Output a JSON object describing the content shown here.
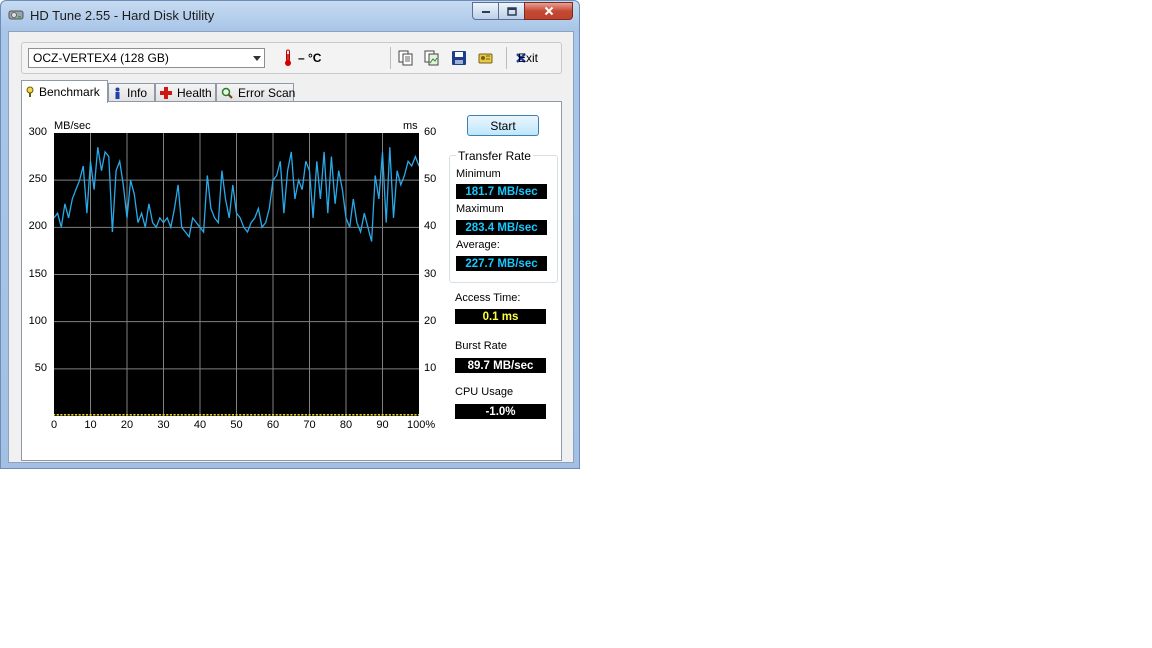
{
  "window": {
    "title": "HD Tune 2.55 - Hard Disk Utility"
  },
  "toolbar": {
    "drive": "OCZ-VERTEX4 (128 GB)",
    "temperature": "– °C",
    "exit_label": "Exit",
    "icons": [
      "copy-info-icon",
      "copy-screenshot-icon",
      "save-icon",
      "options-icon",
      "exit-icon"
    ]
  },
  "tabs": [
    {
      "label": "Benchmark",
      "icon": "benchmark-icon",
      "active": true
    },
    {
      "label": "Info",
      "icon": "info-icon",
      "active": false
    },
    {
      "label": "Health",
      "icon": "health-icon",
      "active": false
    },
    {
      "label": "Error Scan",
      "icon": "magnifier-icon",
      "active": false
    }
  ],
  "chart_data": {
    "type": "line",
    "left_unit": "MB/sec",
    "right_unit": "ms",
    "y_left_ticks": [
      "300",
      "250",
      "200",
      "150",
      "100",
      "50"
    ],
    "y_right_ticks": [
      "60",
      "50",
      "40",
      "30",
      "20",
      "10"
    ],
    "x_ticks": [
      "0",
      "10",
      "20",
      "30",
      "40",
      "50",
      "60",
      "70",
      "80",
      "90",
      "100%"
    ],
    "ylim": [
      0,
      300
    ],
    "ylim_right": [
      0,
      60
    ],
    "xlim": [
      0,
      100
    ],
    "grid": true,
    "series": [
      {
        "color": "#29a9e8",
        "x": [
          0,
          1,
          2,
          3,
          4,
          5,
          6,
          7,
          8,
          9,
          10,
          11,
          12,
          13,
          14,
          15,
          16,
          17,
          18,
          19,
          20,
          21,
          22,
          23,
          24,
          25,
          26,
          27,
          28,
          29,
          30,
          31,
          32,
          33,
          34,
          35,
          36,
          37,
          38,
          39,
          40,
          41,
          42,
          43,
          44,
          45,
          46,
          47,
          48,
          49,
          50,
          51,
          52,
          53,
          54,
          55,
          56,
          57,
          58,
          59,
          60,
          61,
          62,
          63,
          64,
          65,
          66,
          67,
          68,
          69,
          70,
          71,
          72,
          73,
          74,
          75,
          76,
          77,
          78,
          79,
          80,
          81,
          82,
          83,
          84,
          85,
          86,
          87,
          88,
          89,
          90,
          91,
          92,
          93,
          94,
          95,
          96,
          97,
          98,
          99,
          100
        ],
        "y": [
          210,
          215,
          200,
          225,
          210,
          230,
          240,
          250,
          265,
          215,
          270,
          240,
          285,
          260,
          280,
          275,
          195,
          260,
          270,
          245,
          210,
          250,
          235,
          205,
          215,
          200,
          225,
          205,
          200,
          210,
          205,
          210,
          200,
          220,
          245,
          200,
          195,
          190,
          210,
          205,
          200,
          195,
          255,
          220,
          210,
          205,
          260,
          230,
          210,
          245,
          215,
          210,
          200,
          195,
          205,
          210,
          220,
          200,
          205,
          220,
          250,
          255,
          270,
          215,
          260,
          280,
          230,
          250,
          240,
          270,
          260,
          210,
          270,
          230,
          280,
          215,
          275,
          225,
          260,
          240,
          210,
          200,
          230,
          205,
          195,
          215,
          200,
          185,
          255,
          230,
          280,
          205,
          285,
          210,
          260,
          245,
          255,
          270,
          265,
          275,
          265
        ]
      },
      {
        "color": "#e0d020",
        "x": [
          0,
          10,
          20,
          30,
          40,
          50,
          60,
          70,
          80,
          90,
          100
        ],
        "y": [
          0.1,
          0.1,
          0.1,
          0.1,
          0.1,
          0.1,
          0.1,
          0.1,
          0.1,
          0.1,
          0.1
        ]
      }
    ]
  },
  "benchmark": {
    "start_label": "Start",
    "transfer_rate_title": "Transfer Rate",
    "minimum_label": "Minimum",
    "minimum_value": "181.7 MB/sec",
    "maximum_label": "Maximum",
    "maximum_value": "283.4 MB/sec",
    "average_label": "Average:",
    "average_value": "227.7 MB/sec",
    "access_time_label": "Access Time:",
    "access_time_value": "0.1 ms",
    "burst_rate_label": "Burst Rate",
    "burst_rate_value": "89.7 MB/sec",
    "cpu_usage_label": "CPU Usage",
    "cpu_usage_value": "-1.0%"
  },
  "colors": {
    "plot_bg": "#000000",
    "grid": "#808080",
    "transfer_line": "#29a9e8",
    "access_points": "#e0d020",
    "value_blue": "#19c8ff",
    "value_yellow": "#ffff40",
    "value_white": "#ffffff"
  }
}
